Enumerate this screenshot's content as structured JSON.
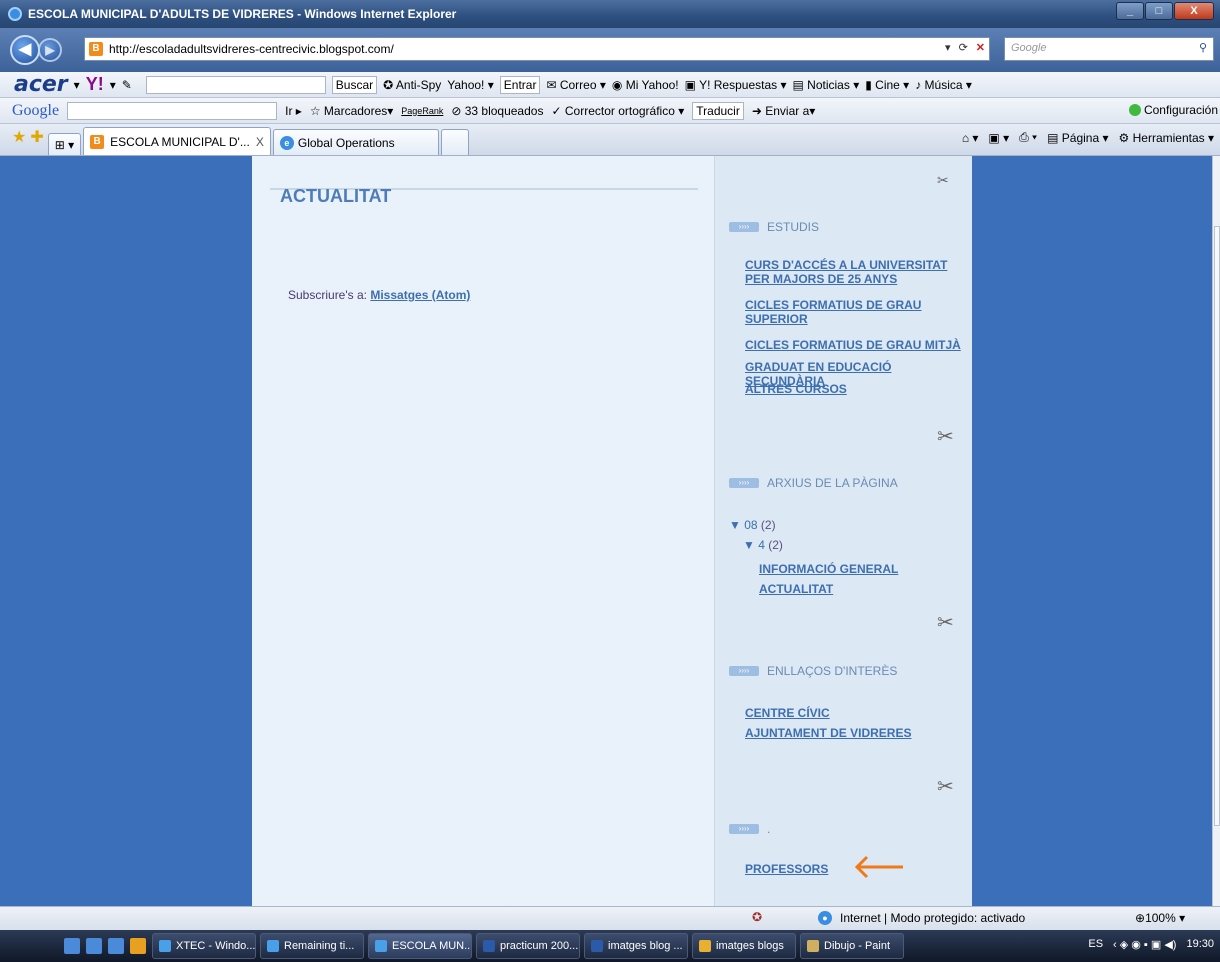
{
  "window": {
    "title": "ESCOLA MUNICIPAL D'ADULTS DE VIDRERES - Windows Internet Explorer"
  },
  "address": {
    "url": "http://escoladadultsvidreres-centrecivic.blogspot.com/",
    "search_placeholder": "Google"
  },
  "yahoo_toolbar": {
    "brand": "acer",
    "yahoo": "Y!",
    "buscar": "Buscar",
    "antispy": "Anti-Spy",
    "yahoo_mail": "Yahoo!",
    "entrar": "Entrar",
    "correo": "Correo",
    "mi_yahoo": "Mi Yahoo!",
    "respuestas": "Y! Respuestas",
    "noticias": "Noticias",
    "cine": "Cine",
    "musica": "Música"
  },
  "google_toolbar": {
    "brand": "Google",
    "ir": "Ir",
    "marcadores": "Marcadores",
    "pagerank": "PageRank",
    "bloqueados": "33 bloqueados",
    "corrector": "Corrector ortográfico",
    "traducir": "Traducir",
    "enviar": "Enviar a",
    "config": "Configuración"
  },
  "tabs": [
    {
      "label": "ESCOLA MUNICIPAL D'...",
      "close": "X"
    },
    {
      "label": "Global Operations"
    }
  ],
  "command_bar": {
    "pagina": "Página",
    "herramientas": "Herramientas"
  },
  "main": {
    "title": "ACTUALITAT",
    "subscribe_prefix": "Subscriure's a:",
    "subscribe_link": "Missatges (Atom)"
  },
  "sidebar": {
    "estudis": {
      "title": "ESTUDIS",
      "links": [
        "CURS D'ACCÉS A LA UNIVERSITAT PER MAJORS DE 25 ANYS",
        "CICLES FORMATIUS DE GRAU SUPERIOR",
        "CICLES FORMATIUS DE GRAU MITJÀ",
        "GRADUAT EN EDUCACIÓ SECUNDÀRIA",
        "ALTRES CURSOS"
      ]
    },
    "arxius": {
      "title": "ARXIUS DE LA PÀGINA",
      "year": "08",
      "year_count": "(2)",
      "month": "4",
      "month_count": "(2)",
      "posts": [
        "INFORMACIÓ GENERAL",
        "ACTUALITAT"
      ]
    },
    "enllacos": {
      "title": "ENLLAÇOS D'INTERÈS",
      "links": [
        "CENTRE CÍVIC",
        "AJUNTAMENT DE VIDRERES"
      ]
    },
    "dot_widget": {
      "title": ".",
      "link": "PROFESSORS"
    },
    "colors": {
      "link": "#3d6fb0",
      "title": "#6a8bb5",
      "arrow": "#f07a1a"
    }
  },
  "status": {
    "zone": "Internet | Modo protegido: activado",
    "zoom": "100%"
  },
  "taskbar": {
    "items": [
      "XTEC - Windo...",
      "Remaining ti...",
      "ESCOLA MUN...",
      "practicum 200...",
      "imatges blog ...",
      "imatges blogs",
      "Dibujo - Paint"
    ],
    "lang": "ES",
    "time": "19:30"
  }
}
